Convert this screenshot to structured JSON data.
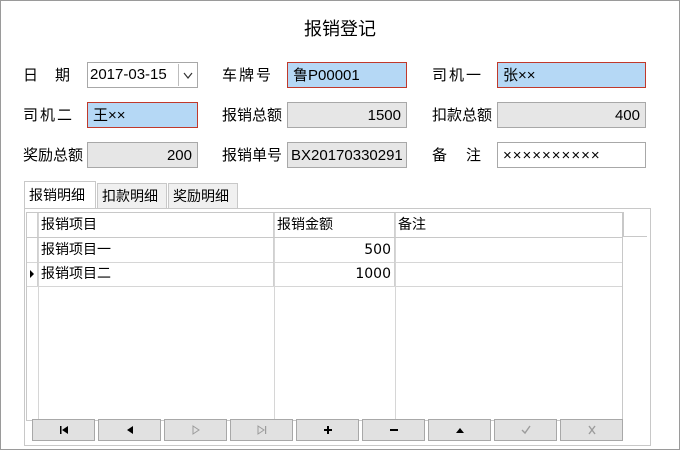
{
  "title": "报销登记",
  "form": {
    "date_label": "日　期",
    "date_value": "2017-03-15",
    "plate_label": "车牌号",
    "plate_value": "鲁P00001",
    "driver1_label": "司机一",
    "driver1_value": "张××",
    "driver2_label": "司机二",
    "driver2_value": "王××",
    "total_label": "报销总额",
    "total_value": "1500",
    "deduct_label": "扣款总额",
    "deduct_value": "400",
    "reward_label": "奖励总额",
    "reward_value": "200",
    "order_label": "报销单号",
    "order_value": "BX20170330291",
    "remark_label": "备　注",
    "remark_value": "××××××××××"
  },
  "tabs": [
    "报销明细",
    "扣款明细",
    "奖励明细"
  ],
  "grid": {
    "columns": [
      "报销项目",
      "报销金额",
      "备注"
    ],
    "rows": [
      {
        "item": "报销项目一",
        "amount": "500",
        "note": ""
      },
      {
        "item": "报销项目二",
        "amount": "1000",
        "note": ""
      }
    ]
  },
  "navigator": {
    "first": "◂|",
    "prev": "◀",
    "next": "▷",
    "last": "▷|",
    "insert": "+",
    "delete": "−",
    "edit": "▲",
    "post": "✓",
    "cancel": "✕"
  },
  "colors": {
    "highlight_field": "#b5d8f5",
    "readonly_field": "#e6e6e6",
    "required_border": "#c0392b"
  }
}
